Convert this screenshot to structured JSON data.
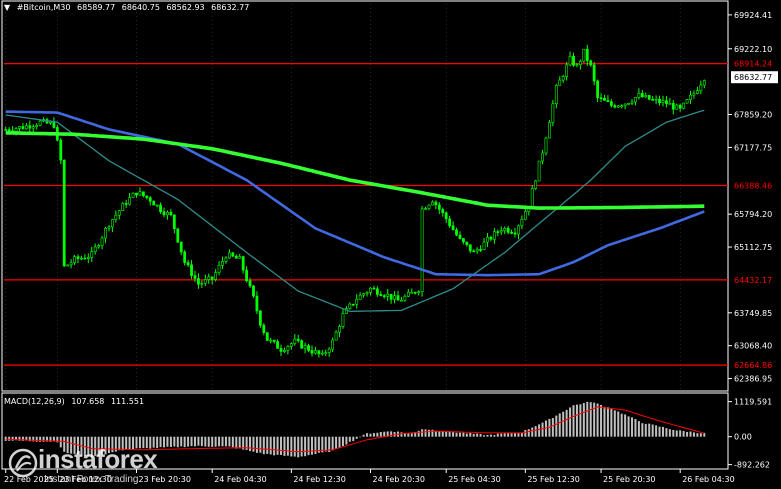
{
  "header": {
    "arrow": "▼",
    "symbol": "#Bitcoin,M30",
    "open": "68589.77",
    "high": "68640.75",
    "low": "68562.93",
    "close": "68632.77"
  },
  "macd_header": {
    "label": "MACD(12,26,9)",
    "main": "107.658",
    "signal": "111.551"
  },
  "logo": {
    "brand": "instaforex",
    "tagline": "Instant Forex Trading"
  },
  "colors": {
    "background": "#000000",
    "candle": "#00ff00",
    "ma_fast": "#2e8b8b",
    "ma_mid": "#4169e1",
    "ma_slow": "#33ff33",
    "level_line": "#ff0000",
    "macd_hist": "#c0c0c0",
    "macd_signal": "#ff0000"
  },
  "chart_data": [
    {
      "type": "candlestick",
      "title": "#Bitcoin,M30",
      "ylim": [
        62150,
        70150
      ],
      "y_ticks": [
        "69924.41",
        "69222.10",
        "67859.20",
        "67177.75",
        "65794.20",
        "65112.75",
        "63749.85",
        "63068.40",
        "62386.95"
      ],
      "y_tick_values": [
        69924.41,
        69222.1,
        67859.2,
        67177.75,
        65794.2,
        65112.75,
        63749.85,
        63068.4,
        62386.95
      ],
      "x_ticks": [
        "22 Feb 2025",
        "23 Feb 12:30",
        "23 Feb 20:30",
        "24 Feb 04:30",
        "24 Feb 12:30",
        "24 Feb 20:30",
        "25 Feb 04:30",
        "25 Feb 12:30",
        "25 Feb 20:30",
        "26 Feb 04:30"
      ],
      "levels": [
        {
          "value": 68914.24,
          "label": "68914.24"
        },
        {
          "value": 66388.46,
          "label": "66388.46"
        },
        {
          "value": 64432.17,
          "label": "64432.17"
        },
        {
          "value": 62664.86,
          "label": "62664.86"
        }
      ],
      "current_price": {
        "value": 68632.77,
        "label": "68632.77"
      },
      "close_path": [
        [
          0,
          67550
        ],
        [
          5,
          67600
        ],
        [
          10,
          67700
        ],
        [
          14,
          67650
        ],
        [
          16,
          66900
        ],
        [
          17,
          64700
        ],
        [
          20,
          64850
        ],
        [
          25,
          64950
        ],
        [
          30,
          65600
        ],
        [
          35,
          66050
        ],
        [
          38,
          66250
        ],
        [
          42,
          66100
        ],
        [
          45,
          65900
        ],
        [
          48,
          65750
        ],
        [
          52,
          64800
        ],
        [
          56,
          64350
        ],
        [
          60,
          64450
        ],
        [
          64,
          64950
        ],
        [
          68,
          64850
        ],
        [
          72,
          64050
        ],
        [
          74,
          63550
        ],
        [
          76,
          63200
        ],
        [
          80,
          63000
        ],
        [
          84,
          63150
        ],
        [
          88,
          63000
        ],
        [
          92,
          62850
        ],
        [
          95,
          63150
        ],
        [
          98,
          63700
        ],
        [
          102,
          64050
        ],
        [
          106,
          64250
        ],
        [
          110,
          64150
        ],
        [
          114,
          64000
        ],
        [
          118,
          64150
        ],
        [
          120,
          64250
        ],
        [
          121,
          65900
        ],
        [
          124,
          66100
        ],
        [
          128,
          65700
        ],
        [
          132,
          65250
        ],
        [
          136,
          65000
        ],
        [
          140,
          65250
        ],
        [
          144,
          65500
        ],
        [
          148,
          65450
        ],
        [
          152,
          66000
        ],
        [
          156,
          67100
        ],
        [
          160,
          68400
        ],
        [
          164,
          69000
        ],
        [
          166,
          68850
        ],
        [
          168,
          69150
        ],
        [
          170,
          68850
        ],
        [
          172,
          68200
        ],
        [
          176,
          68050
        ],
        [
          180,
          68100
        ],
        [
          184,
          68250
        ],
        [
          188,
          68150
        ],
        [
          192,
          68100
        ],
        [
          196,
          67950
        ],
        [
          200,
          68300
        ],
        [
          203,
          68633
        ]
      ],
      "ma_fast_path": [
        [
          0,
          67850
        ],
        [
          15,
          67700
        ],
        [
          30,
          66900
        ],
        [
          50,
          66100
        ],
        [
          70,
          65000
        ],
        [
          85,
          64200
        ],
        [
          100,
          63780
        ],
        [
          115,
          63800
        ],
        [
          130,
          64250
        ],
        [
          145,
          65000
        ],
        [
          160,
          65900
        ],
        [
          170,
          66500
        ],
        [
          180,
          67200
        ],
        [
          192,
          67700
        ],
        [
          203,
          67950
        ]
      ],
      "ma_mid_path": [
        [
          0,
          67920
        ],
        [
          15,
          67900
        ],
        [
          30,
          67550
        ],
        [
          50,
          67250
        ],
        [
          70,
          66500
        ],
        [
          90,
          65500
        ],
        [
          110,
          64900
        ],
        [
          125,
          64550
        ],
        [
          140,
          64530
        ],
        [
          155,
          64550
        ],
        [
          165,
          64800
        ],
        [
          175,
          65150
        ],
        [
          190,
          65500
        ],
        [
          203,
          65850
        ]
      ],
      "ma_slow_path": [
        [
          0,
          67480
        ],
        [
          20,
          67450
        ],
        [
          40,
          67350
        ],
        [
          60,
          67150
        ],
        [
          80,
          66850
        ],
        [
          100,
          66500
        ],
        [
          120,
          66250
        ],
        [
          140,
          65980
        ],
        [
          155,
          65920
        ],
        [
          175,
          65930
        ],
        [
          195,
          65950
        ],
        [
          203,
          65960
        ]
      ]
    },
    {
      "type": "bar",
      "title": "MACD(12,26,9)",
      "series": [
        {
          "name": "107.658",
          "type": "histogram"
        },
        {
          "name": "111.551",
          "type": "line"
        }
      ],
      "ylim": [
        -1000,
        1300
      ],
      "y_ticks": [
        "1119.591",
        "0.00",
        "-892.262"
      ],
      "y_tick_values": [
        1119.591,
        0.0,
        -892.262
      ],
      "hist_path": [
        [
          0,
          -120
        ],
        [
          15,
          -160
        ],
        [
          17,
          -500
        ],
        [
          25,
          -650
        ],
        [
          35,
          -400
        ],
        [
          45,
          -350
        ],
        [
          55,
          -300
        ],
        [
          65,
          -320
        ],
        [
          75,
          -550
        ],
        [
          85,
          -650
        ],
        [
          95,
          -450
        ],
        [
          105,
          100
        ],
        [
          112,
          180
        ],
        [
          118,
          100
        ],
        [
          121,
          250
        ],
        [
          130,
          150
        ],
        [
          140,
          50
        ],
        [
          150,
          150
        ],
        [
          158,
          550
        ],
        [
          165,
          1000
        ],
        [
          170,
          1119
        ],
        [
          176,
          900
        ],
        [
          185,
          450
        ],
        [
          195,
          200
        ],
        [
          203,
          108
        ]
      ],
      "signal_path": [
        [
          0,
          -80
        ],
        [
          17,
          -150
        ],
        [
          25,
          -380
        ],
        [
          40,
          -420
        ],
        [
          55,
          -380
        ],
        [
          70,
          -350
        ],
        [
          85,
          -480
        ],
        [
          95,
          -420
        ],
        [
          105,
          -100
        ],
        [
          115,
          100
        ],
        [
          125,
          180
        ],
        [
          140,
          120
        ],
        [
          150,
          120
        ],
        [
          158,
          300
        ],
        [
          165,
          650
        ],
        [
          172,
          950
        ],
        [
          180,
          850
        ],
        [
          190,
          500
        ],
        [
          203,
          112
        ]
      ]
    }
  ]
}
